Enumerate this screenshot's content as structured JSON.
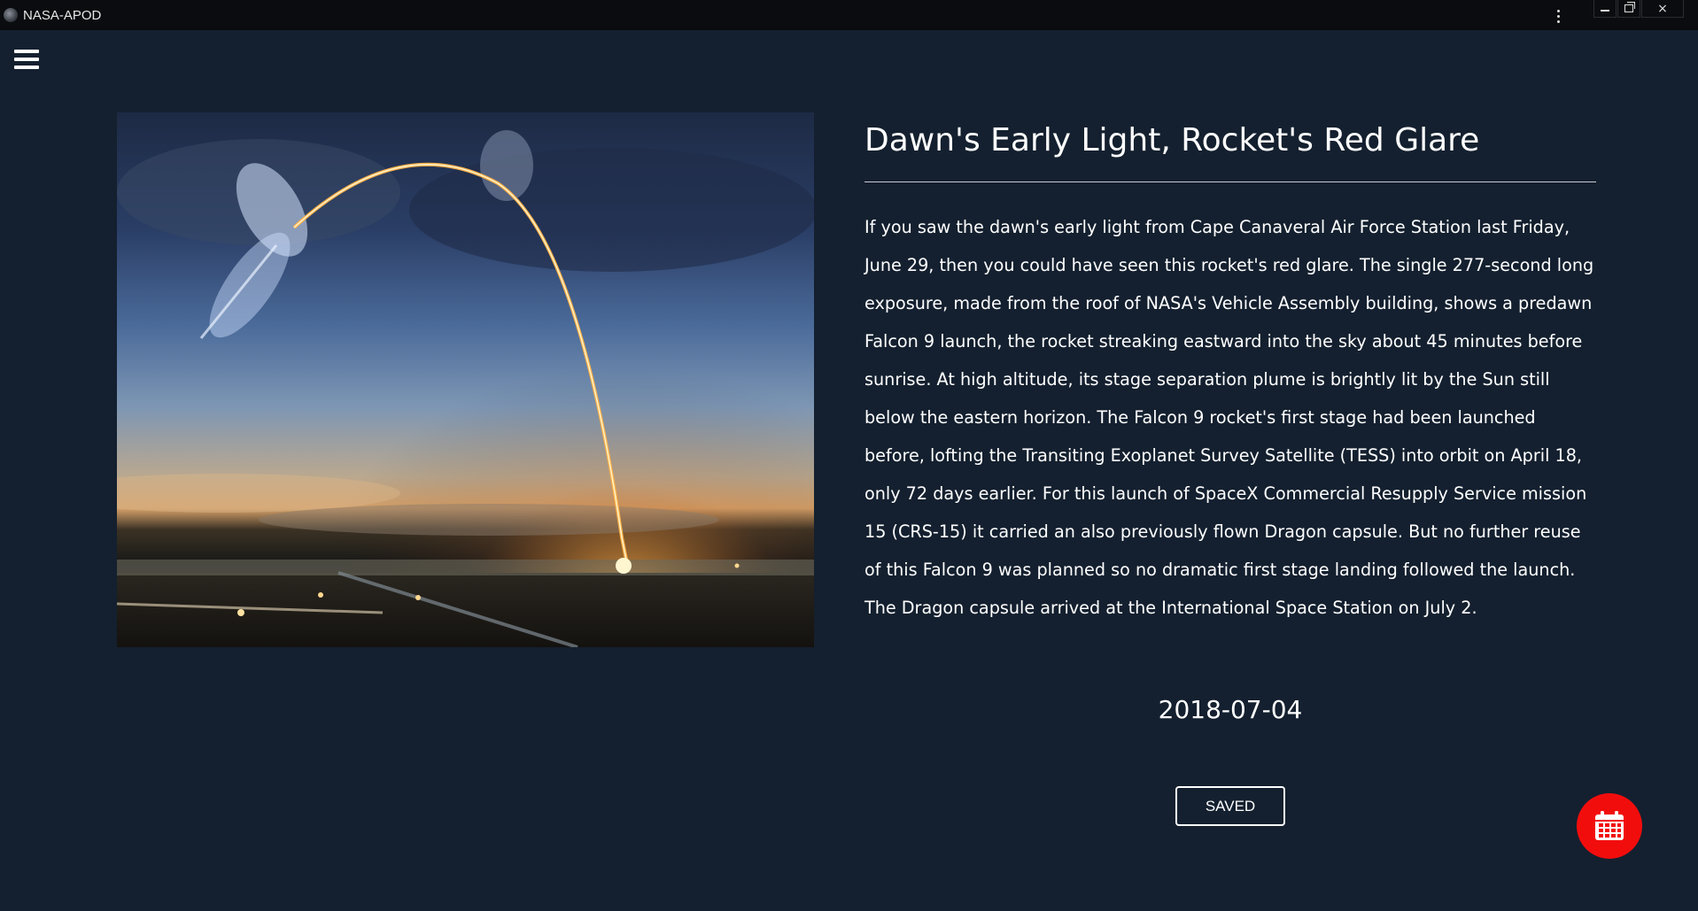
{
  "window": {
    "title": "NASA-APOD",
    "controls": {
      "minimize": "minimize",
      "maximize": "restore",
      "close": "×"
    }
  },
  "apod": {
    "title": "Dawn's Early Light, Rocket's Red Glare",
    "explanation": "If you saw the dawn's early light from Cape Canaveral Air Force Station last Friday, June 29, then you could have seen this rocket's red glare. The single 277-second long exposure, made from the roof of NASA's Vehicle Assembly building, shows a predawn Falcon 9 launch, the rocket streaking eastward into the sky about 45 minutes before sunrise. At high altitude, its stage separation plume is brightly lit by the Sun still below the eastern horizon. The Falcon 9 rocket's first stage had been launched before, lofting the Transiting Exoplanet Survey Satellite (TESS) into orbit on April 18, only 72 days earlier. For this launch of SpaceX Commercial Resupply Service mission 15 (CRS-15) it carried an also previously flown Dragon capsule. But no further reuse of this Falcon 9 was planned so no dramatic first stage landing followed the launch. The Dragon capsule arrived at the International Space Station on July 2.",
    "date": "2018-07-04",
    "saved_label": "SAVED"
  },
  "icons": {
    "menu": "hamburger-menu-icon",
    "more": "kebab-menu-icon",
    "calendar": "calendar-icon"
  },
  "colors": {
    "background": "#14202f",
    "titlebar": "#0a0c0f",
    "fab": "#f20d0d",
    "text": "#ffffff"
  }
}
